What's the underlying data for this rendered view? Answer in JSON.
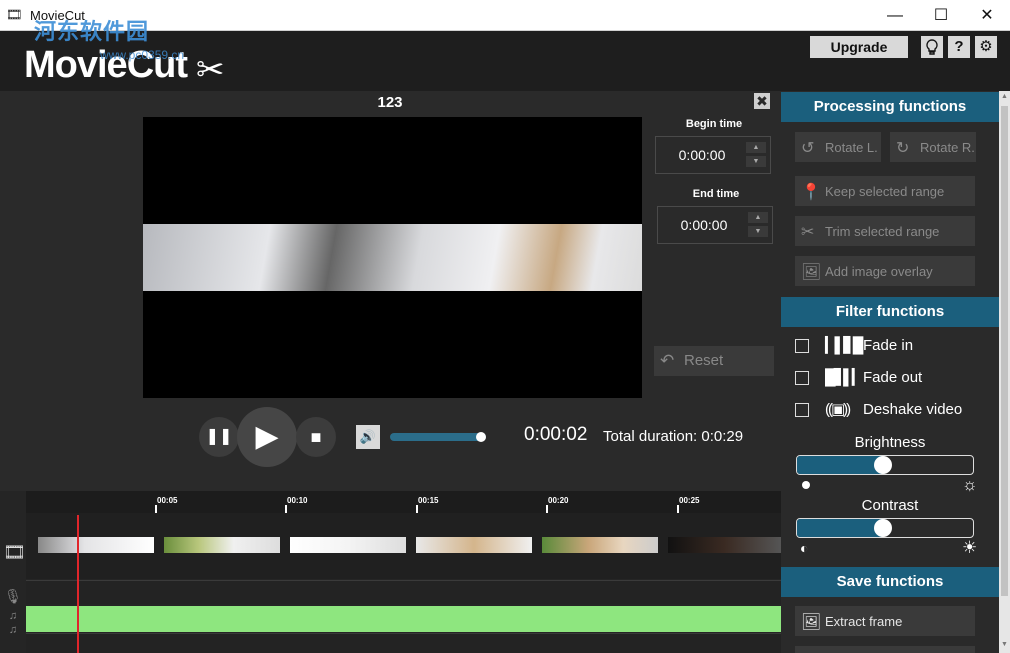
{
  "window": {
    "title": "MovieCut",
    "minimize": "—",
    "maximize": "☐",
    "close": "✕"
  },
  "watermark": {
    "text": "河东软件园",
    "url": "www.pc0359.cn"
  },
  "header": {
    "logo": "MovieCut",
    "upgrade_label": "Upgrade",
    "icons": [
      "lightbulb-icon",
      "help-icon",
      "gear-icon"
    ],
    "help_glyph": "?",
    "bulb_glyph": "💡",
    "gear_glyph": "⚙"
  },
  "player": {
    "clip_title": "123",
    "begin_time_label": "Begin time",
    "begin_time_value": "0:00:00",
    "end_time_label": "End time",
    "end_time_value": "0:00:00",
    "reset_label": "Reset",
    "current_time": "0:00:02",
    "total_duration": "Total duration: 0:0:29",
    "volume_level": 0.95
  },
  "timeline": {
    "ticks": [
      "00:05",
      "00:10",
      "00:15",
      "00:20",
      "00:25"
    ]
  },
  "processing": {
    "title": "Processing functions",
    "rotate_left": "Rotate L.",
    "rotate_right": "Rotate R.",
    "keep_range": "Keep selected range",
    "trim_range": "Trim selected range",
    "add_overlay": "Add image overlay"
  },
  "filters": {
    "title": "Filter functions",
    "fade_in": "Fade in",
    "fade_out": "Fade out",
    "deshake": "Deshake video",
    "brightness_label": "Brightness",
    "brightness_level": 0.49,
    "contrast_label": "Contrast",
    "contrast_level": 0.49
  },
  "save": {
    "title": "Save functions",
    "extract_frame": "Extract frame"
  },
  "colors": {
    "accent": "#1b5f7d",
    "audio_track": "#8ee67f",
    "playhead": "#e0262b"
  }
}
